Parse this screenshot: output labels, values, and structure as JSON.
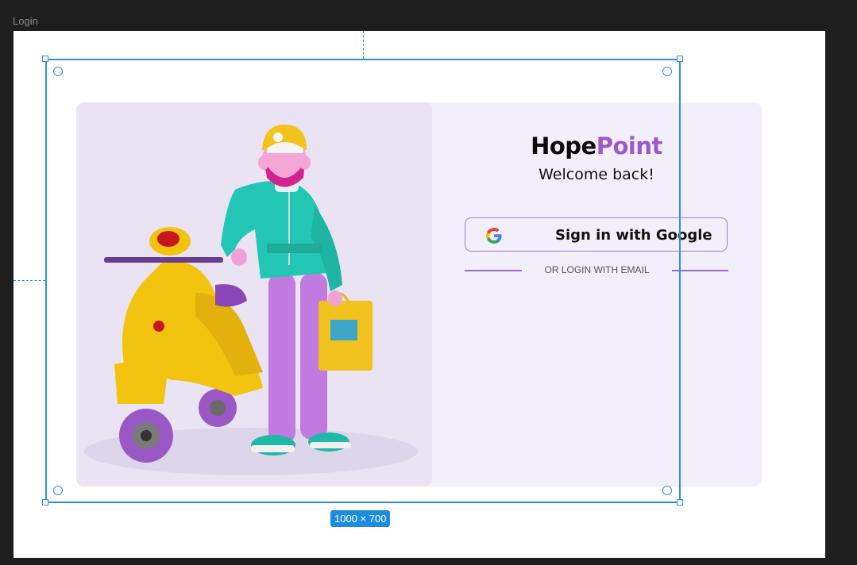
{
  "canvas": {
    "frame_name": "Login",
    "selection_size": "1000 × 700"
  },
  "login": {
    "brand_part1": "Hope",
    "brand_part2": "Point",
    "welcome": "Welcome back!",
    "google_button_label": "Sign in with Google",
    "divider_text": "OR LOGIN WITH EMAIL"
  },
  "colors": {
    "accent": "#9b59c9",
    "selection": "#2d8fe0",
    "card_bg": "#f3effa",
    "illustration_bg": "#e9e3f3"
  },
  "icons": {
    "google": "google-g-icon"
  }
}
